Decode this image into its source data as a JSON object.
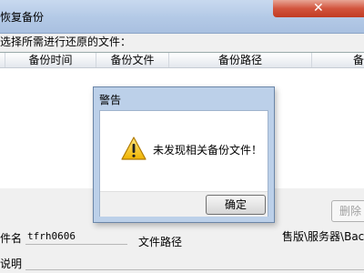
{
  "window": {
    "title": "恢复备份"
  },
  "prompt": "选择所需进行还原的文件：",
  "table": {
    "columns": [
      "备份时间",
      "备份文件",
      "备份路径",
      "备"
    ]
  },
  "details": {
    "file_name_label": "件名",
    "file_name_value": "tfrh0606",
    "file_path_label": "文件路径",
    "file_path_value": "售版\\服务器\\Bac",
    "description_label": "说明",
    "delete_label": "删除"
  },
  "dialog": {
    "title": "警告",
    "message": "未发现相关备份文件！",
    "ok_label": "确定",
    "icon": "warning-icon"
  }
}
